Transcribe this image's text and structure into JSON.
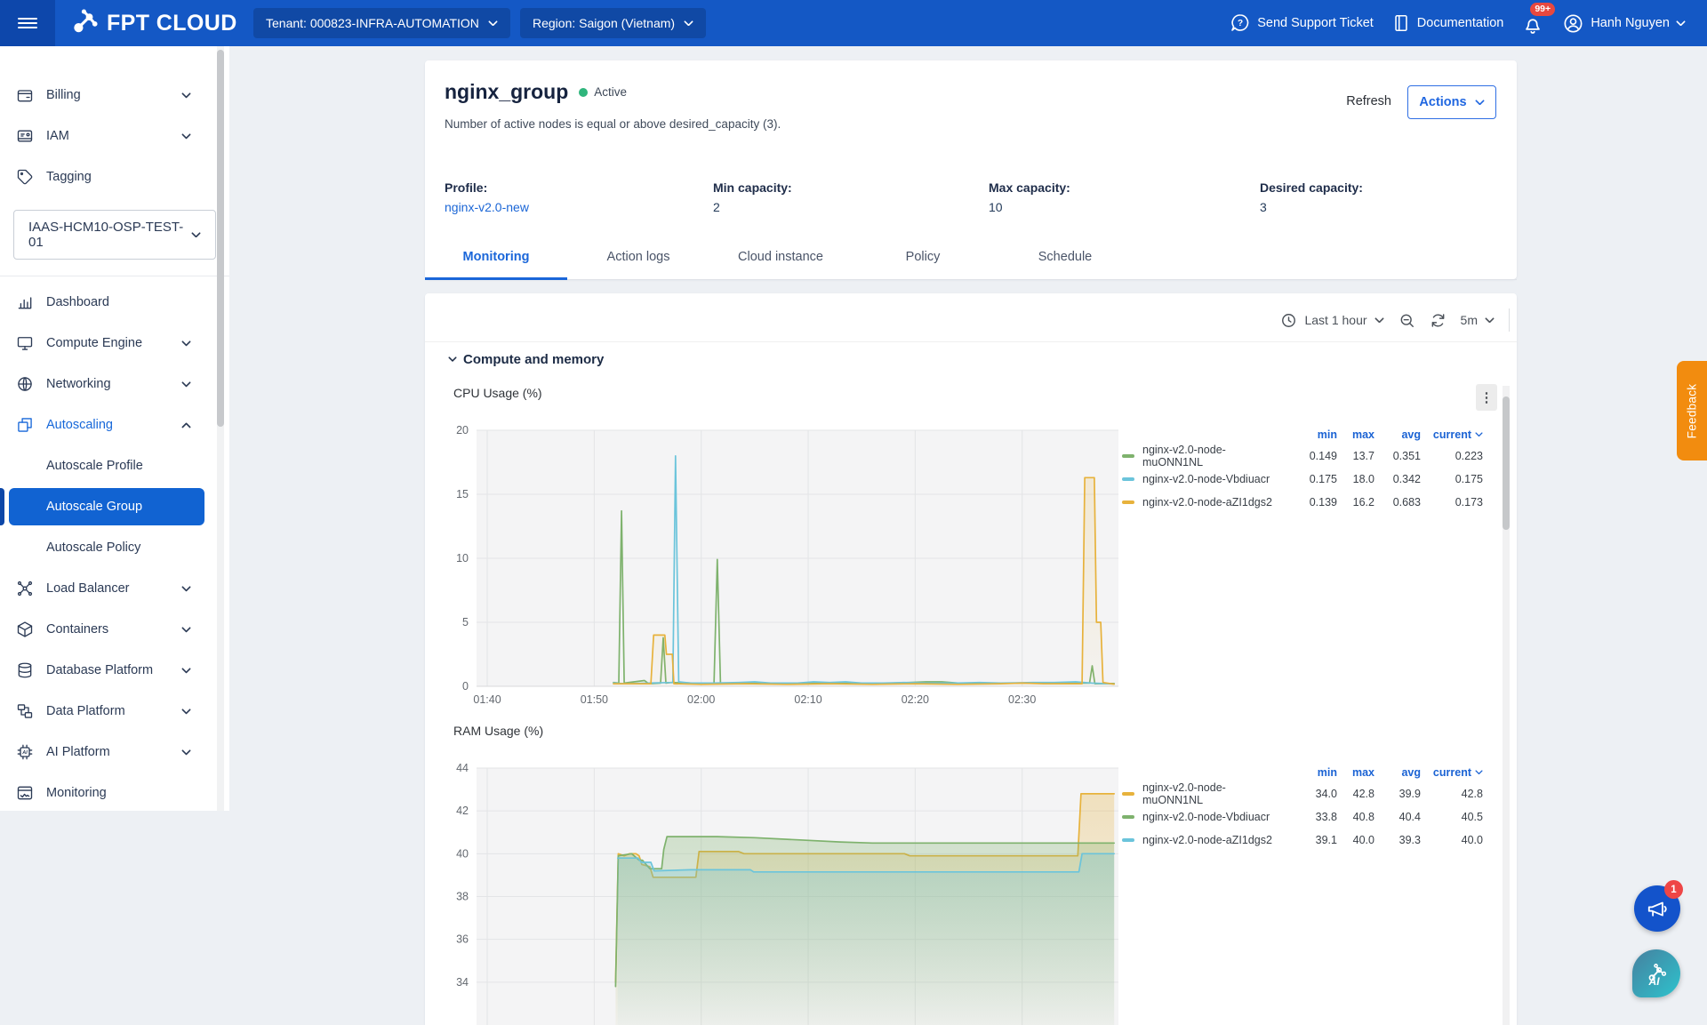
{
  "header": {
    "brand": "FPT CLOUD",
    "tenant": "Tenant: 000823-INFRA-AUTOMATION",
    "region": "Region: Saigon (Vietnam)",
    "support_label": "Send Support Ticket",
    "docs_label": "Documentation",
    "notif_badge": "99+",
    "user_name": "Hanh Nguyen"
  },
  "sidebar": {
    "top_items": [
      {
        "label": "Billing",
        "icon": "wallet-icon",
        "chevron": "down"
      },
      {
        "label": "IAM",
        "icon": "id-card-icon",
        "chevron": "down"
      },
      {
        "label": "Tagging",
        "icon": "tag-icon"
      }
    ],
    "project": "IAAS-HCM10-OSP-TEST-01",
    "items": [
      {
        "label": "Dashboard",
        "icon": "bar-chart-icon"
      },
      {
        "label": "Compute Engine",
        "icon": "monitor-icon",
        "chevron": "down"
      },
      {
        "label": "Networking",
        "icon": "globe-icon",
        "chevron": "down"
      },
      {
        "label": "Autoscaling",
        "icon": "autoscale-icon",
        "chevron": "up",
        "expanded": true
      },
      {
        "label": "Autoscale Profile",
        "child": true
      },
      {
        "label": "Autoscale Group",
        "child": true,
        "active": true
      },
      {
        "label": "Autoscale Policy",
        "child": true
      },
      {
        "label": "Load Balancer",
        "icon": "load-balancer-icon",
        "chevron": "down"
      },
      {
        "label": "Containers",
        "icon": "box-icon",
        "chevron": "down"
      },
      {
        "label": "Database Platform",
        "icon": "database-icon",
        "chevron": "down"
      },
      {
        "label": "Data Platform",
        "icon": "data-platform-icon",
        "chevron": "down"
      },
      {
        "label": "AI Platform",
        "icon": "chip-icon",
        "chevron": "down"
      },
      {
        "label": "Monitoring",
        "icon": "monitor-wave-icon"
      }
    ]
  },
  "page": {
    "title": "nginx_group",
    "status": "Active",
    "description": "Number of active nodes is equal or above desired_capacity (3).",
    "refresh_label": "Refresh",
    "actions_label": "Actions",
    "fields": [
      {
        "label": "Profile:",
        "value": "nginx-v2.0-new",
        "link": true
      },
      {
        "label": "Min capacity:",
        "value": "2"
      },
      {
        "label": "Max capacity:",
        "value": "10"
      },
      {
        "label": "Desired capacity:",
        "value": "3"
      }
    ],
    "tabs": [
      {
        "label": "Monitoring",
        "active": true
      },
      {
        "label": "Action logs"
      },
      {
        "label": "Cloud instance"
      },
      {
        "label": "Policy"
      },
      {
        "label": "Schedule"
      }
    ]
  },
  "monitoring": {
    "time_range": "Last 1 hour",
    "refresh_interval": "5m",
    "section_title": "Compute and memory",
    "legend_headers": [
      "min",
      "max",
      "avg",
      "current"
    ]
  },
  "chart_data": [
    {
      "id": "cpu",
      "type": "line",
      "title": "CPU Usage (%)",
      "ylim": [
        0,
        20
      ],
      "yticks": [
        20,
        15,
        10,
        5,
        0
      ],
      "xlim": [
        99,
        159
      ],
      "xtick_minutes": [
        100,
        110,
        120,
        130,
        140,
        150
      ],
      "xtick_labels": [
        "01:40",
        "01:50",
        "02:00",
        "02:10",
        "02:20",
        "02:30"
      ],
      "grid": true,
      "legend_position": "right-table",
      "series": [
        {
          "name": "nginx-v2.0-node-muONN1NL",
          "color": "#7EB26D",
          "fill": false,
          "min": "0.149",
          "max": "13.7",
          "avg": "0.351",
          "current": "0.223",
          "points": [
            [
              111.8,
              0.3
            ],
            [
              112.3,
              0.25
            ],
            [
              112.55,
              13.7
            ],
            [
              112.8,
              0.25
            ],
            [
              114.7,
              0.45
            ],
            [
              115.1,
              0.2
            ],
            [
              116.2,
              0.25
            ],
            [
              116.45,
              3.8
            ],
            [
              116.7,
              0.25
            ],
            [
              117.2,
              0.3
            ],
            [
              121.2,
              0.2
            ],
            [
              121.5,
              9.9
            ],
            [
              121.8,
              0.2
            ],
            [
              124,
              0.25
            ],
            [
              127,
              0.2
            ],
            [
              130,
              0.25
            ],
            [
              134,
              0.25
            ],
            [
              138,
              0.25
            ],
            [
              141,
              0.35
            ],
            [
              142.5,
              0.35
            ],
            [
              144,
              0.25
            ],
            [
              148,
              0.25
            ],
            [
              151,
              0.25
            ],
            [
              155,
              0.25
            ],
            [
              156.3,
              0.25
            ],
            [
              156.55,
              1.6
            ],
            [
              156.8,
              0.2
            ],
            [
              158.6,
              0.22
            ]
          ]
        },
        {
          "name": "nginx-v2.0-node-Vbdiuacr",
          "color": "#6BC4DB",
          "fill": false,
          "min": "0.175",
          "max": "18.0",
          "avg": "0.342",
          "current": "0.175",
          "points": [
            [
              111.8,
              0.25
            ],
            [
              113,
              0.2
            ],
            [
              115,
              0.25
            ],
            [
              117.35,
              0.3
            ],
            [
              117.6,
              18.0
            ],
            [
              117.9,
              0.35
            ],
            [
              119,
              0.25
            ],
            [
              121,
              0.25
            ],
            [
              123.5,
              0.3
            ],
            [
              125,
              0.35
            ],
            [
              126.5,
              0.25
            ],
            [
              129,
              0.25
            ],
            [
              130.5,
              0.35
            ],
            [
              132,
              0.3
            ],
            [
              133.5,
              0.35
            ],
            [
              135,
              0.25
            ],
            [
              137,
              0.25
            ],
            [
              139,
              0.3
            ],
            [
              141,
              0.25
            ],
            [
              144,
              0.25
            ],
            [
              146,
              0.3
            ],
            [
              148,
              0.25
            ],
            [
              151,
              0.3
            ],
            [
              153,
              0.3
            ],
            [
              155,
              0.35
            ],
            [
              156.5,
              0.25
            ],
            [
              158.6,
              0.18
            ]
          ]
        },
        {
          "name": "nginx-v2.0-node-aZI1dgs2",
          "color": "#E7B23C",
          "fill": true,
          "min": "0.139",
          "max": "16.2",
          "avg": "0.683",
          "current": "0.173",
          "points": [
            [
              111.8,
              0.2
            ],
            [
              115.3,
              0.2
            ],
            [
              115.55,
              4.0
            ],
            [
              116.6,
              4.0
            ],
            [
              116.75,
              2.5
            ],
            [
              117.3,
              2.5
            ],
            [
              117.45,
              0.2
            ],
            [
              120,
              0.15
            ],
            [
              124,
              0.2
            ],
            [
              128,
              0.15
            ],
            [
              132,
              0.2
            ],
            [
              136,
              0.15
            ],
            [
              140,
              0.2
            ],
            [
              144,
              0.15
            ],
            [
              148,
              0.2
            ],
            [
              150,
              0.25
            ],
            [
              152,
              0.2
            ],
            [
              155.6,
              0.2
            ],
            [
              155.85,
              16.3
            ],
            [
              156.75,
              16.3
            ],
            [
              156.95,
              5.0
            ],
            [
              157.35,
              5.0
            ],
            [
              157.55,
              0.3
            ],
            [
              158.6,
              0.17
            ]
          ]
        }
      ]
    },
    {
      "id": "ram",
      "type": "area",
      "title": "RAM Usage (%)",
      "ylim": [
        32,
        44
      ],
      "yticks": [
        44,
        42,
        40,
        38,
        36,
        34
      ],
      "xlim": [
        99,
        159
      ],
      "xtick_minutes": [
        100,
        110,
        120,
        130,
        140,
        150
      ],
      "xtick_labels": [],
      "grid": true,
      "legend_position": "right-table",
      "series": [
        {
          "name": "nginx-v2.0-node-muONN1NL",
          "color": "#E7B23C",
          "fill": true,
          "min": "34.0",
          "max": "42.8",
          "avg": "39.9",
          "current": "42.8",
          "points": [
            [
              112.0,
              34.0
            ],
            [
              112.25,
              40.0
            ],
            [
              112.8,
              39.9
            ],
            [
              113.3,
              40.0
            ],
            [
              113.9,
              40.0
            ],
            [
              114.2,
              39.9
            ],
            [
              114.45,
              39.5
            ],
            [
              115.2,
              39.4
            ],
            [
              115.5,
              38.9
            ],
            [
              119.5,
              38.9
            ],
            [
              119.8,
              40.1
            ],
            [
              123.5,
              40.1
            ],
            [
              124,
              40.0
            ],
            [
              139,
              40.0
            ],
            [
              139.5,
              39.9
            ],
            [
              155.2,
              39.9
            ],
            [
              155.5,
              42.8
            ],
            [
              158.6,
              42.8
            ]
          ]
        },
        {
          "name": "nginx-v2.0-node-Vbdiuacr",
          "color": "#7EB26D",
          "fill": true,
          "min": "33.8",
          "max": "40.8",
          "avg": "40.4",
          "current": "40.5",
          "points": [
            [
              112.0,
              33.8
            ],
            [
              112.25,
              39.9
            ],
            [
              113.5,
              40.0
            ],
            [
              114.2,
              39.7
            ],
            [
              114.5,
              39.7
            ],
            [
              115.2,
              39.3
            ],
            [
              116.3,
              39.3
            ],
            [
              116.5,
              40.2
            ],
            [
              116.8,
              40.8
            ],
            [
              121.5,
              40.8
            ],
            [
              125,
              40.75
            ],
            [
              129,
              40.65
            ],
            [
              133,
              40.55
            ],
            [
              136,
              40.5
            ],
            [
              158.6,
              40.5
            ]
          ]
        },
        {
          "name": "nginx-v2.0-node-aZI1dgs2",
          "color": "#6BC4DB",
          "fill": true,
          "min": "39.1",
          "max": "40.0",
          "avg": "39.3",
          "current": "40.0",
          "points": [
            [
              112.2,
              39.8
            ],
            [
              114.1,
              39.8
            ],
            [
              114.4,
              39.6
            ],
            [
              115.3,
              39.6
            ],
            [
              115.6,
              39.2
            ],
            [
              119,
              39.25
            ],
            [
              124.6,
              39.25
            ],
            [
              124.9,
              39.15
            ],
            [
              139,
              39.15
            ],
            [
              155.3,
              39.15
            ],
            [
              155.6,
              40.0
            ],
            [
              158.6,
              40.0
            ]
          ]
        }
      ]
    }
  ],
  "feedback_label": "Feedback",
  "floating_badge": "1"
}
